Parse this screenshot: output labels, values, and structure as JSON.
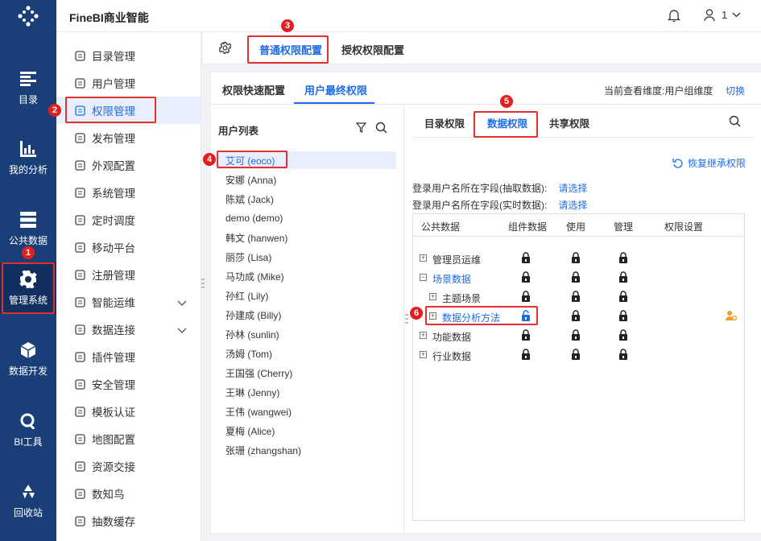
{
  "app": {
    "title": "FineBI商业智能",
    "user_label": "1"
  },
  "nav": {
    "items": [
      {
        "label": "目录",
        "icon": "catalog-icon"
      },
      {
        "label": "我的分析",
        "icon": "analysis-chart-icon"
      },
      {
        "label": "公共数据",
        "icon": "database-icon"
      },
      {
        "label": "管理系统",
        "icon": "gear-icon"
      },
      {
        "label": "数据开发",
        "icon": "cube-icon"
      },
      {
        "label": "BI工具",
        "icon": "tools-icon"
      },
      {
        "label": "回收站",
        "icon": "recycle-icon"
      }
    ]
  },
  "menu": {
    "items": [
      {
        "label": "目录管理",
        "icon": "list-icon"
      },
      {
        "label": "用户管理",
        "icon": "user-icon"
      },
      {
        "label": "权限管理",
        "icon": "permission-icon"
      },
      {
        "label": "发布管理",
        "icon": "publish-icon"
      },
      {
        "label": "外观配置",
        "icon": "appearance-icon"
      },
      {
        "label": "系统管理",
        "icon": "settings-icon"
      },
      {
        "label": "定时调度",
        "icon": "timer-icon"
      },
      {
        "label": "移动平台",
        "icon": "mobile-icon"
      },
      {
        "label": "注册管理",
        "icon": "register-icon"
      },
      {
        "label": "智能运维",
        "icon": "ops-icon"
      },
      {
        "label": "数据连接",
        "icon": "link-icon"
      },
      {
        "label": "插件管理",
        "icon": "plugin-icon"
      },
      {
        "label": "安全管理",
        "icon": "shield-icon"
      },
      {
        "label": "模板认证",
        "icon": "template-icon"
      },
      {
        "label": "地图配置",
        "icon": "map-icon"
      },
      {
        "label": "资源交接",
        "icon": "resource-icon"
      },
      {
        "label": "数知鸟",
        "icon": "bird-icon"
      },
      {
        "label": "抽数缓存",
        "icon": "cache-icon"
      }
    ]
  },
  "top_tabs": {
    "tab1": "普通权限配置",
    "tab2": "授权权限配置"
  },
  "sub_tabs": {
    "tab1": "权限快速配置",
    "tab2": "用户最终权限",
    "view_dim": "当前查看维度:用户组维度",
    "switch": "切换"
  },
  "user_list": {
    "title": "用户列表",
    "users": [
      "艾可 (eoco)",
      "安娜 (Anna)",
      "陈斌 (Jack)",
      "demo (demo)",
      "韩文 (hanwen)",
      "丽莎 (Lisa)",
      "马功成 (Mike)",
      "孙红 (Lily)",
      "孙建成 (Billy)",
      "孙林 (sunlin)",
      "汤姆 (Tom)",
      "王国强 (Cherry)",
      "王琳 (Jenny)",
      "王伟 (wangwei)",
      "夏梅 (Alice)",
      "张珊 (zhangshan)"
    ]
  },
  "perm": {
    "tabs": [
      "目录权限",
      "数据权限",
      "共享权限"
    ],
    "restore": "恢复继承权限",
    "field1": "登录用户名所在字段(抽取数据):",
    "field2": "登录用户名所在字段(实时数据):",
    "choose": "请选择",
    "columns": [
      "公共数据",
      "组件数据",
      "使用",
      "管理",
      "权限设置"
    ],
    "rows": [
      {
        "name": "管理员运维",
        "expander": "+"
      },
      {
        "name": "场景数据",
        "expander": "−"
      },
      {
        "name": "主题场景",
        "expander": "+"
      },
      {
        "name": "数据分析方法",
        "expander": "+"
      },
      {
        "name": "功能数据",
        "expander": "+"
      },
      {
        "name": "行业数据",
        "expander": "+"
      }
    ]
  },
  "badges": [
    "1",
    "2",
    "3",
    "4",
    "5",
    "6"
  ],
  "colors": {
    "nav_bg": "#1a3f78",
    "accent": "#1e6de5",
    "annotation": "#e02020"
  }
}
